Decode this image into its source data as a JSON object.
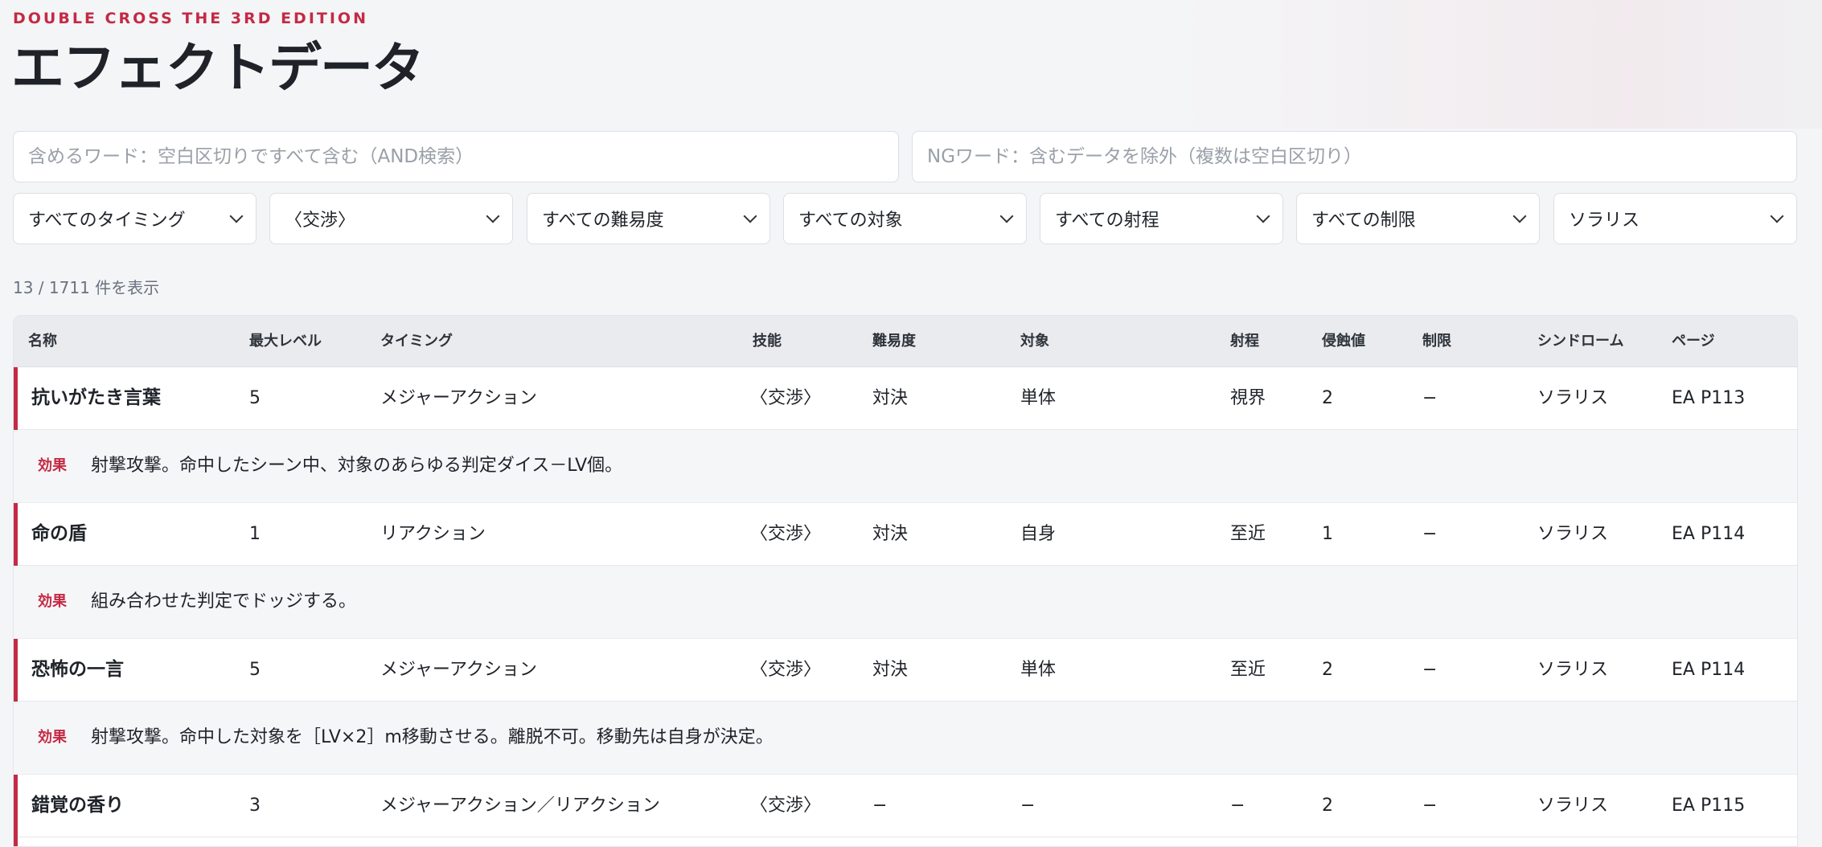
{
  "header": {
    "brand": "DOUBLE CROSS THE 3RD EDITION",
    "title": "エフェクトデータ"
  },
  "search": {
    "include_placeholder": "含めるワード：空白区切りですべて含む（AND検索）",
    "exclude_placeholder": "NGワード：含むデータを除外（複数は空白区切り）"
  },
  "filters": {
    "timing": "すべてのタイミング",
    "skill": "〈交渉〉",
    "difficulty": "すべての難易度",
    "target": "すべての対象",
    "range": "すべての射程",
    "limit": "すべての制限",
    "syndrome": "ソラリス"
  },
  "result_count": "13 / 1711 件を表示",
  "table": {
    "headers": {
      "name": "名称",
      "max_level": "最大レベル",
      "timing": "タイミング",
      "skill": "技能",
      "difficulty": "難易度",
      "target": "対象",
      "range": "射程",
      "erosion": "侵蝕値",
      "limit": "制限",
      "syndrome": "シンドローム",
      "page": "ページ"
    },
    "effect_label": "効果",
    "rows": [
      {
        "name": "抗いがたき言葉",
        "max_level": "5",
        "timing": "メジャーアクション",
        "skill": "〈交渉〉",
        "difficulty": "対決",
        "target": "単体",
        "range": "視界",
        "erosion": "2",
        "limit": "−",
        "syndrome": "ソラリス",
        "page": "EA P113",
        "effect": "射撃攻撃。命中したシーン中、対象のあらゆる判定ダイス－LV個。"
      },
      {
        "name": "命の盾",
        "max_level": "1",
        "timing": "リアクション",
        "skill": "〈交渉〉",
        "difficulty": "対決",
        "target": "自身",
        "range": "至近",
        "erosion": "1",
        "limit": "−",
        "syndrome": "ソラリス",
        "page": "EA P114",
        "effect": "組み合わせた判定でドッジする。"
      },
      {
        "name": "恐怖の一言",
        "max_level": "5",
        "timing": "メジャーアクション",
        "skill": "〈交渉〉",
        "difficulty": "対決",
        "target": "単体",
        "range": "至近",
        "erosion": "2",
        "limit": "−",
        "syndrome": "ソラリス",
        "page": "EA P114",
        "effect": "射撃攻撃。命中した対象を［LV×2］m移動させる。離脱不可。移動先は自身が決定。"
      },
      {
        "name": "錯覚の香り",
        "max_level": "3",
        "timing": "メジャーアクション／リアクション",
        "skill": "〈交渉〉",
        "difficulty": "−",
        "target": "−",
        "range": "−",
        "erosion": "2",
        "limit": "−",
        "syndrome": "ソラリス",
        "page": "EA P115"
      }
    ]
  }
}
